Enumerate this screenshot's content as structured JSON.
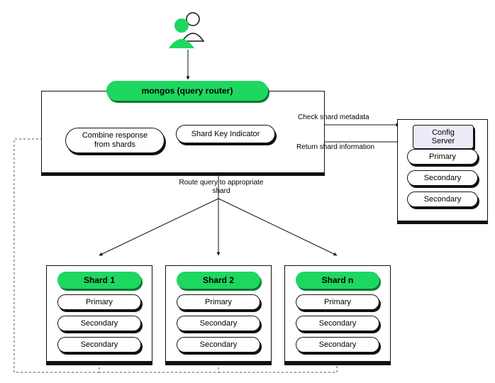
{
  "users_icon": "users",
  "mongos": {
    "title": "mongos (query router)",
    "combine": "Combine response from shards",
    "shard_key": "Shard Key Indicator",
    "route_label": "Route query to appropriate shard"
  },
  "config_server": {
    "title": "Config Server",
    "members": [
      "Primary",
      "Secondary",
      "Secondary"
    ],
    "check_label": "Check shard metadata",
    "return_label": "Return shard information"
  },
  "shards": [
    {
      "name": "Shard 1",
      "members": [
        "Primary",
        "Secondary",
        "Secondary"
      ]
    },
    {
      "name": "Shard 2",
      "members": [
        "Primary",
        "Secondary",
        "Secondary"
      ]
    },
    {
      "name": "Shard n",
      "members": [
        "Primary",
        "Secondary",
        "Secondary"
      ]
    }
  ],
  "colors": {
    "green": "#1ed760",
    "dark_green": "#0a7a33",
    "lavender": "#efeaf8"
  }
}
